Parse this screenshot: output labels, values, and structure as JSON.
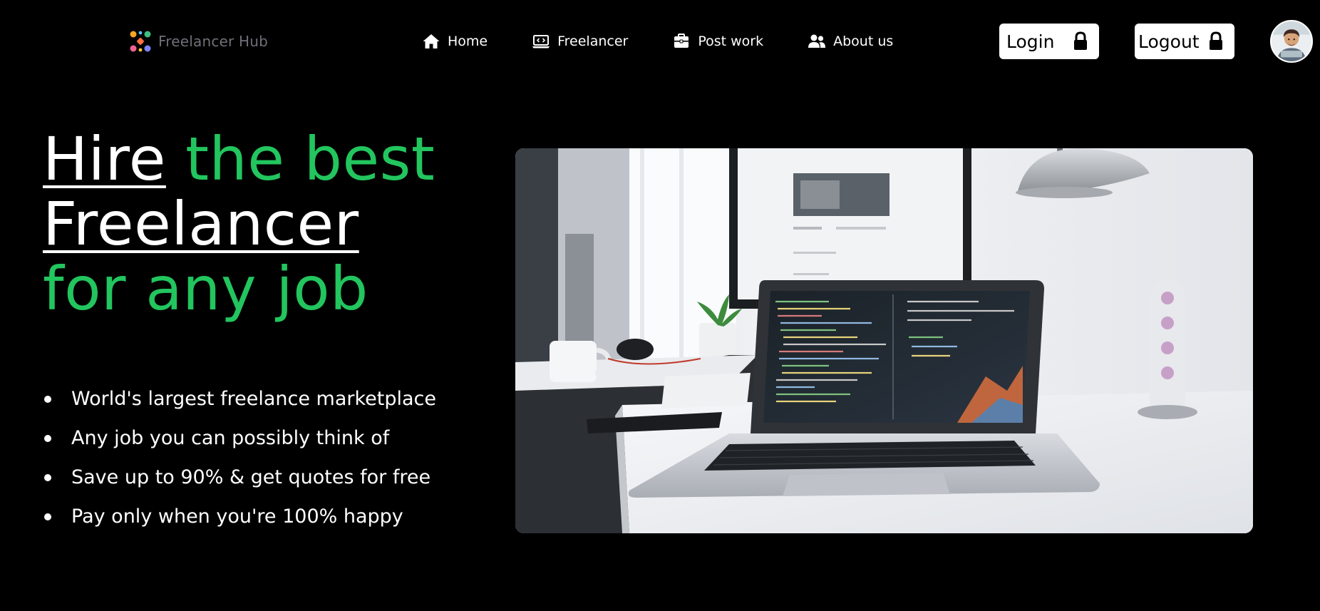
{
  "brand": {
    "name": "Freelancer Hub",
    "logo_icon": "colorful-x-logo-icon"
  },
  "nav": {
    "items": [
      {
        "label": "Home",
        "icon": "house-icon"
      },
      {
        "label": "Freelancer",
        "icon": "laptop-code-icon"
      },
      {
        "label": "Post work",
        "icon": "briefcase-icon"
      },
      {
        "label": "About us",
        "icon": "users-icon"
      }
    ]
  },
  "auth": {
    "login_label": "Login",
    "logout_label": "Logout",
    "icon": "lock-icon"
  },
  "user": {
    "avatar_icon": "user-avatar-icon"
  },
  "hero": {
    "title_part1": "Hire",
    "title_part2": "the best",
    "title_part3": "Freelancer",
    "title_part4": "for any job",
    "features": [
      "World's largest freelance marketplace",
      "Any job you can possibly think of",
      "Save up to 90% & get quotes for free",
      "Pay only when you're 100% happy"
    ],
    "image_icon": "laptop-desk-photo"
  },
  "colors": {
    "background": "#000000",
    "accent_green": "#22c55e",
    "text": "#ffffff",
    "logo_text": "#6f6f78"
  }
}
